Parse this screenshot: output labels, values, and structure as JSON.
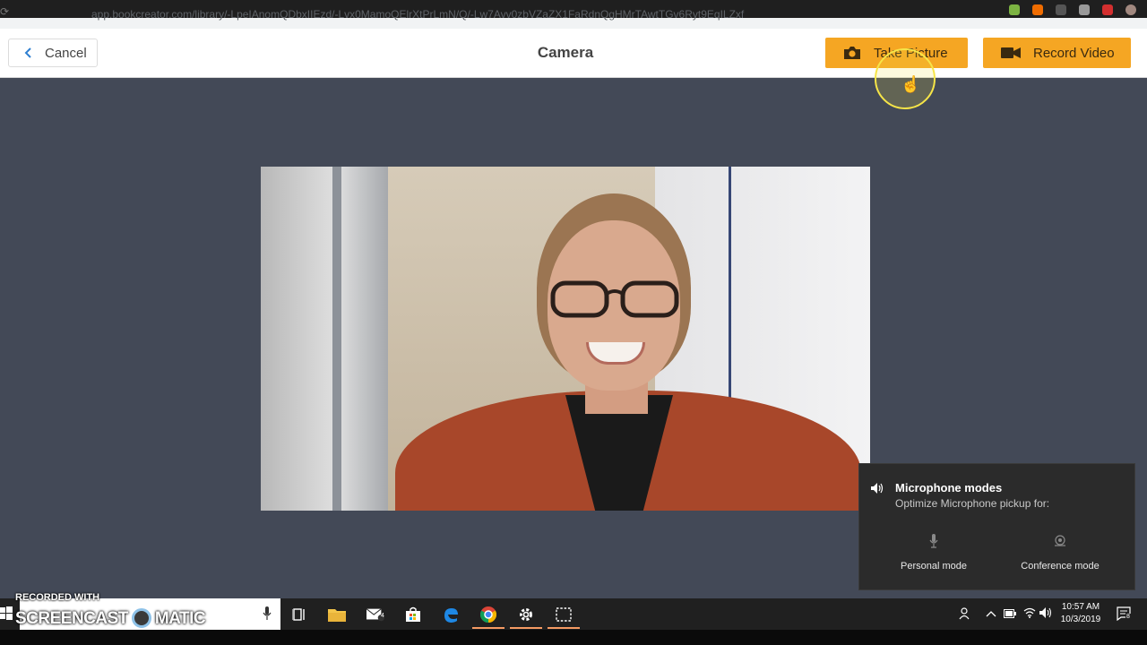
{
  "browser": {
    "url": "app.bookcreator.com/library/-LpeIAnomQDbxIIEzd/-Lvx0MamoQElrXtPrLmN/Q/-Lw7Avv0zbVZaZX1FaRdnQgHMrTAwtTGv6Ryt9EqILZxf"
  },
  "header": {
    "cancel_label": "Cancel",
    "title": "Camera",
    "take_picture_label": "Take Picture",
    "record_video_label": "Record Video"
  },
  "mic_panel": {
    "title": "Microphone modes",
    "subtitle": "Optimize Microphone pickup for:",
    "modes": [
      {
        "label": "Personal mode"
      },
      {
        "label": "Conference mode"
      }
    ]
  },
  "watermark": {
    "line1": "RECORDED WITH",
    "line2_left": "SCREENCAST",
    "line2_right": "MATIC"
  },
  "taskbar": {
    "clock_time": "10:57 AM",
    "clock_date": "10/3/2019",
    "mail_badge": "4",
    "notification_count": "8"
  },
  "colors": {
    "accent_orange": "#f5a623",
    "page_background": "#434957",
    "flyout_background": "#2b2b2b"
  },
  "icons": [
    "chevron-left-icon",
    "camera-icon",
    "video-camera-icon",
    "speaker-icon",
    "microphone-icon",
    "conference-icon",
    "windows-icon",
    "task-view-icon",
    "file-explorer-icon",
    "mail-icon",
    "store-icon",
    "edge-icon",
    "chrome-icon",
    "settings-icon",
    "snip-icon",
    "people-icon",
    "chevron-up-icon",
    "battery-icon",
    "wifi-icon",
    "volume-icon",
    "notification-icon"
  ]
}
